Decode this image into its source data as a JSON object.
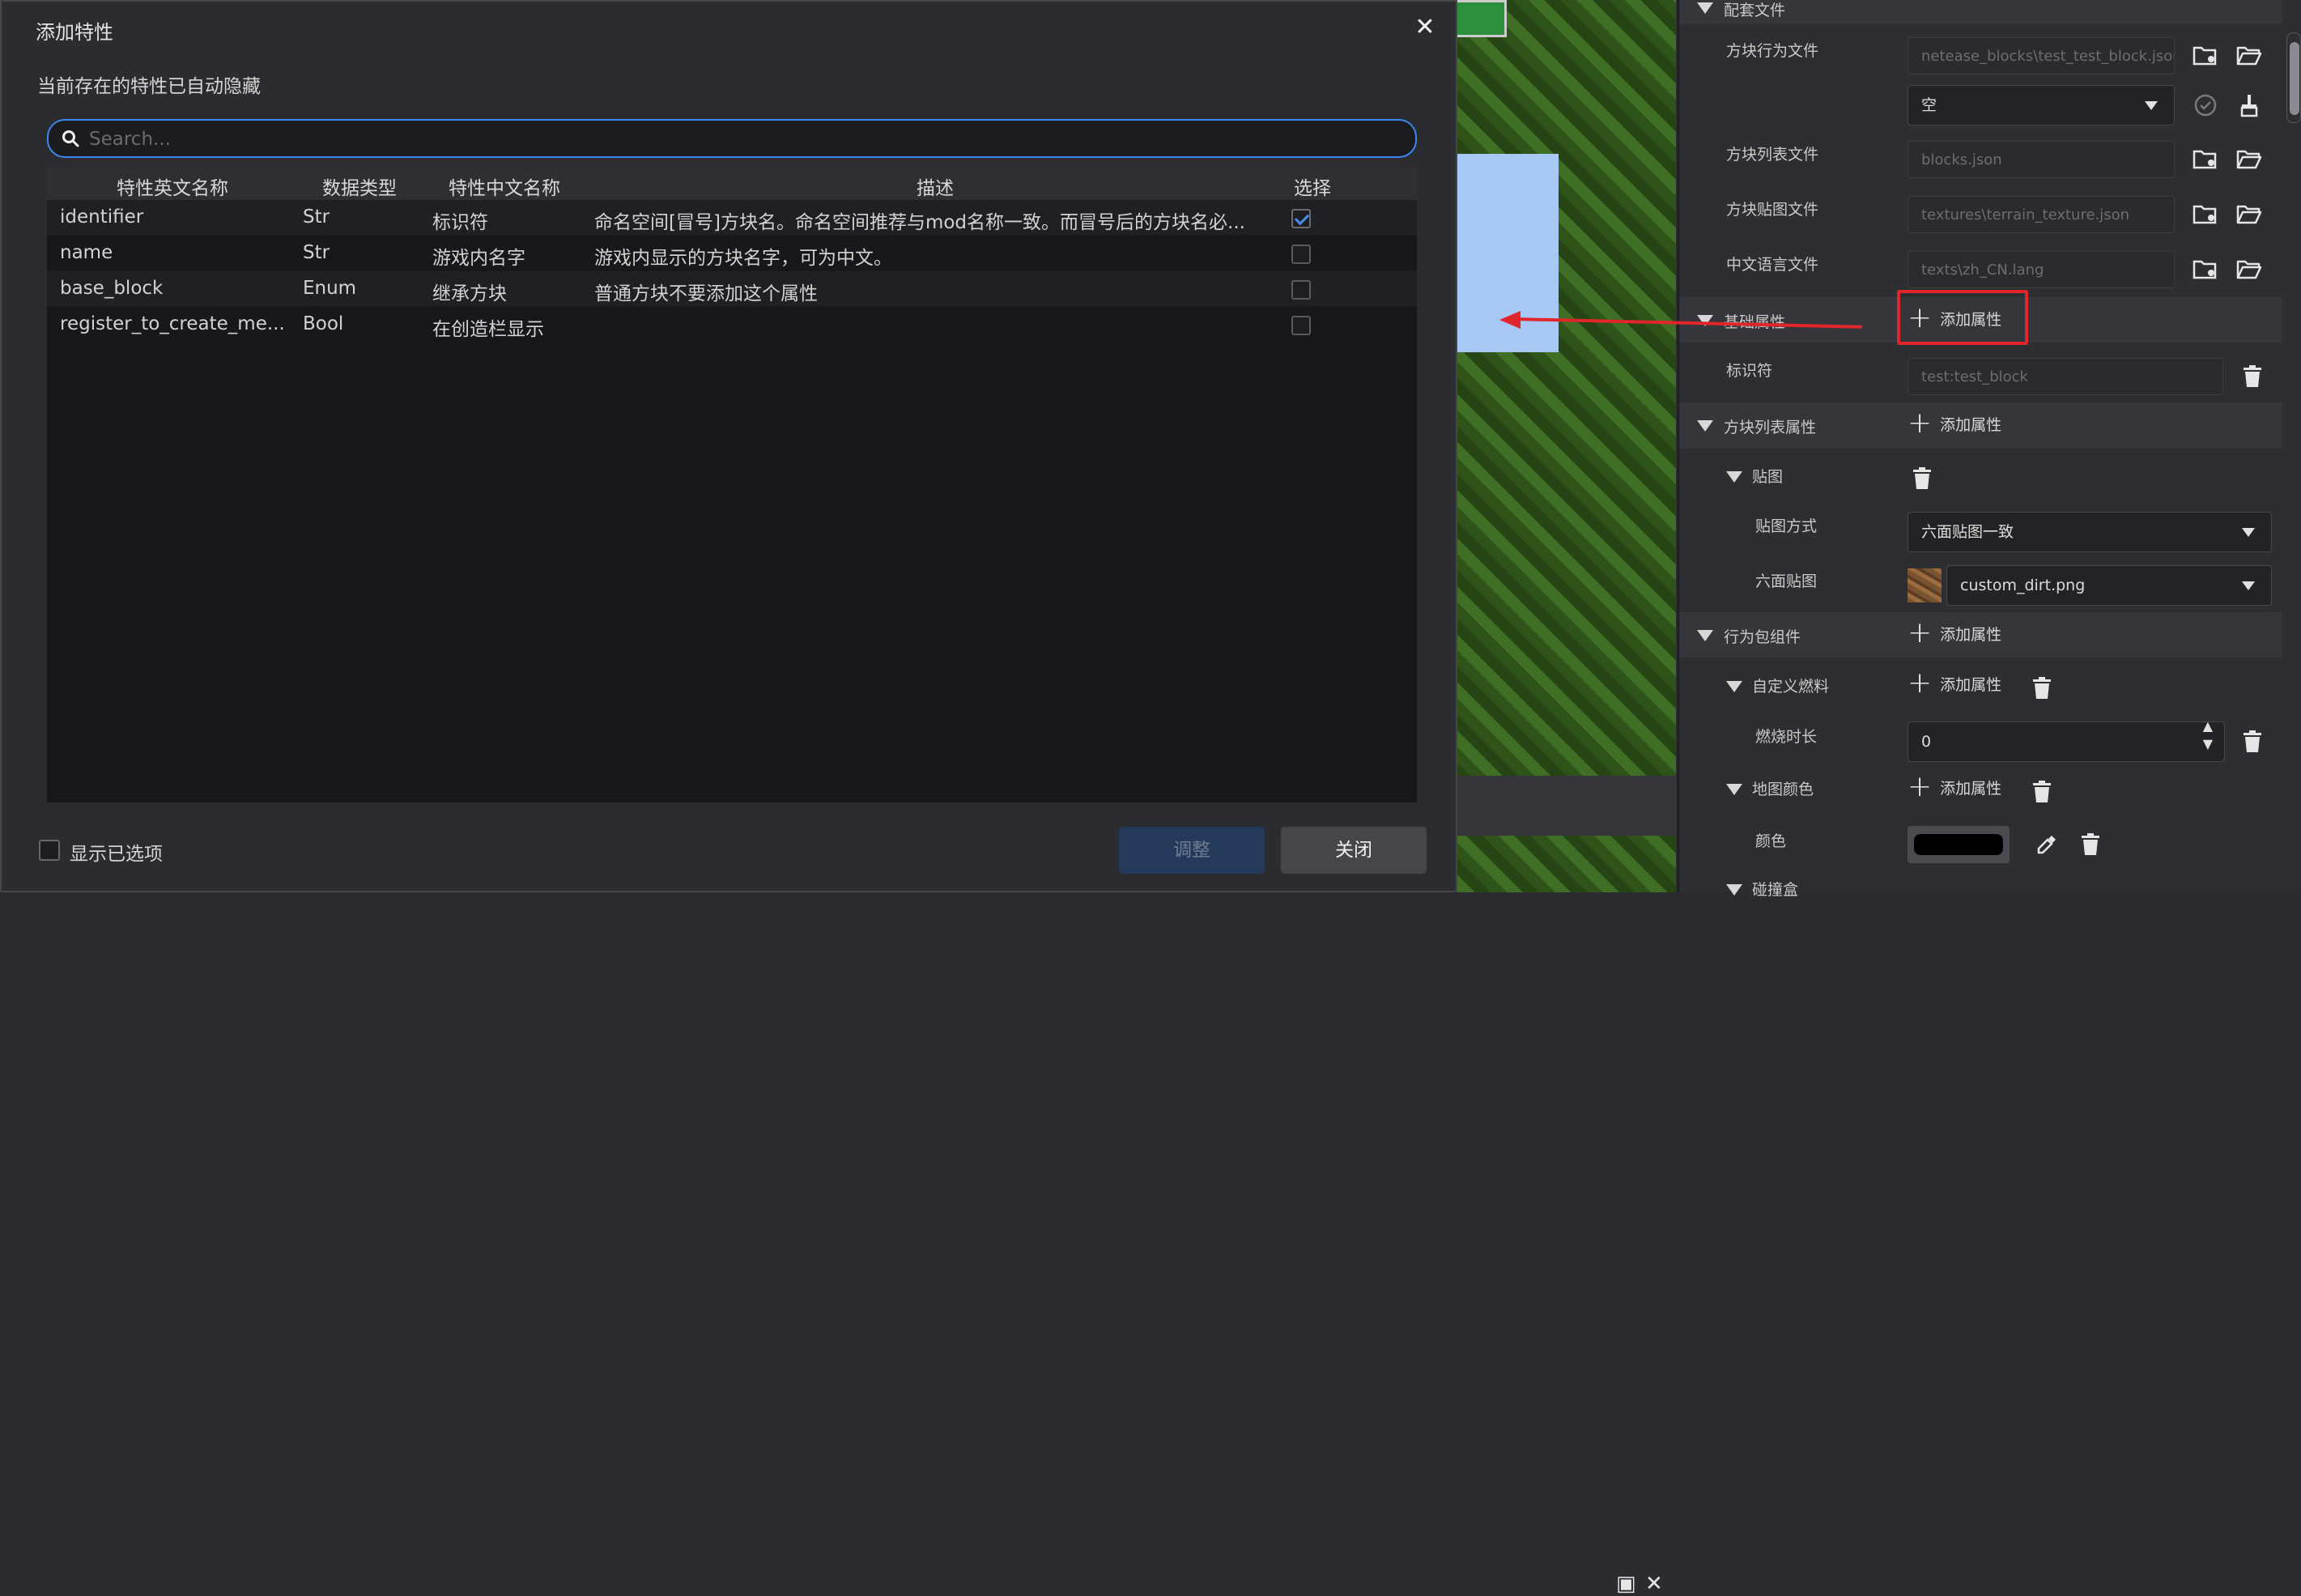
{
  "dialog": {
    "title": "添加特性",
    "subtitle": "当前存在的特性已自动隐藏",
    "search": {
      "placeholder": "Search...",
      "value": ""
    },
    "columns": [
      "特性英文名称",
      "数据类型",
      "特性中文名称",
      "描述",
      "选择"
    ],
    "rows": [
      {
        "name": "identifier",
        "type": "Str",
        "cn": "标识符",
        "desc": "命名空间[冒号]方块名。命名空间推荐与mod名称一致。而冒号后的方块名必...",
        "selected": true
      },
      {
        "name": "name",
        "type": "Str",
        "cn": "游戏内名字",
        "desc": "游戏内显示的方块名字，可为中文。",
        "selected": false
      },
      {
        "name": "base_block",
        "type": "Enum",
        "cn": "继承方块",
        "desc": "普通方块不要添加这个属性",
        "selected": false
      },
      {
        "name": "register_to_create_me...",
        "type": "Bool",
        "cn": "在创造栏显示",
        "desc": "",
        "selected": false
      }
    ],
    "show_selected_label": "显示已选项",
    "adjust_label": "调整",
    "close_label": "关闭"
  },
  "props": {
    "sections": {
      "config_files": "配套文件",
      "basic_attrs": "基础属性",
      "block_list_attrs": "方块列表属性",
      "texture": "贴图",
      "behavior_components": "行为包组件",
      "custom_fuel": "自定义燃料",
      "map_color": "地图颜色",
      "collision": "碰撞盒"
    },
    "labels": {
      "block_behavior_file": "方块行为文件",
      "block_list_file": "方块列表文件",
      "block_texture_file": "方块贴图文件",
      "cn_lang_file": "中文语言文件",
      "identifier": "标识符",
      "texture_mode": "贴图方式",
      "six_face_texture": "六面贴图",
      "burn_time": "燃烧时长",
      "color": "颜色"
    },
    "values": {
      "block_behavior_file": "netease_blocks\\test_test_block.json",
      "behavior_select": "空",
      "block_list_file": "blocks.json",
      "block_texture_file": "textures\\terrain_texture.json",
      "cn_lang_file": "texts\\zh_CN.lang",
      "identifier": "test:test_block",
      "texture_mode": "六面贴图一致",
      "six_face_texture": "custom_dirt.png",
      "burn_time": "0"
    },
    "add_attr_label": "添加属性"
  },
  "colors": {
    "accent": "#3d87f0",
    "highlight": "#e0262a",
    "map_color_swatch": "#000000"
  }
}
